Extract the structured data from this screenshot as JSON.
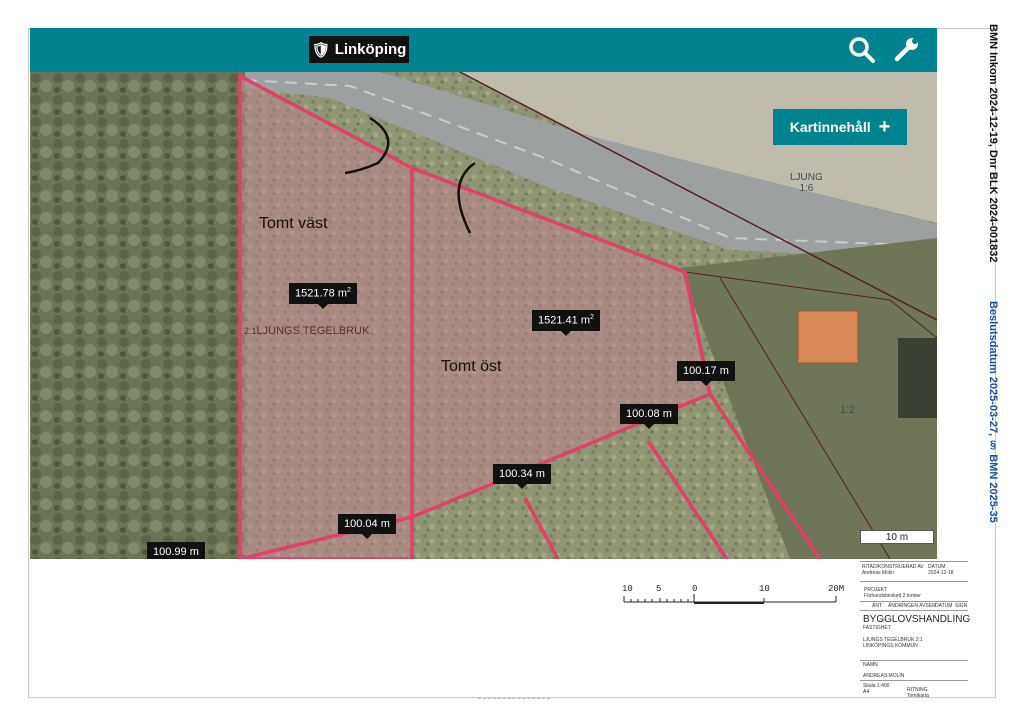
{
  "header": {
    "logo_text": "Linköping",
    "search_icon": "search-icon",
    "tools_icon": "wrench-icon",
    "accent": "#00838f"
  },
  "map_button": {
    "label": "Kartinnehåll",
    "icon": "plus-icon"
  },
  "plots": [
    {
      "name": "Tomt väst",
      "area": "1521.78 m",
      "area_sup": "2"
    },
    {
      "name": "Tomt öst",
      "area": "1521.41 m",
      "area_sup": "2"
    }
  ],
  "measurements": [
    "100.17 m",
    "100.08 m",
    "100.34 m",
    "100.04 m",
    "100.99 m"
  ],
  "map_labels": {
    "property": "LJUNGS TEGELBRUK",
    "property_nr": "2:1",
    "road_name": "LJUNG",
    "road_nr": "1:6",
    "parcel": "1:2",
    "scale_box": "10 m"
  },
  "plot_outline_color": "#e0406a",
  "stamp": {
    "line1": "BMN Inkom  2024-12-19, Dnr BLK 2024-001832",
    "line2": "Beslutsdatum 2025-03-27, § BMN 2025-35"
  },
  "scale_bar": {
    "labels": [
      "10",
      "5",
      "0",
      "10",
      "20M"
    ]
  },
  "title_block": {
    "header_label": "RITAD/KONSTRUERAD AV",
    "date_label": "DATUM",
    "drawn_by": "Andreas Molin",
    "date": "2024-12-18",
    "project_label": "PROJEKT",
    "project": "Förhandsbesked 2 tomter",
    "columns": [
      "ÄNT",
      "ÄNDRINGEN AVSER",
      "DATUM",
      "SIGN"
    ],
    "stage": "BYGGLOVSHANDLING",
    "property_label": "FASTIGHET",
    "property": "LJUNGS TEGELBRUK 2:1",
    "municipality": "LINKÖPINGS KOMMUN",
    "name_label": "NAMN",
    "name": "ANDREAS MOLIN",
    "scale_label": "Skala",
    "scale": "1:400",
    "paper": "A4",
    "drawing_label": "RITNING",
    "drawing": "Tomtkarta"
  }
}
